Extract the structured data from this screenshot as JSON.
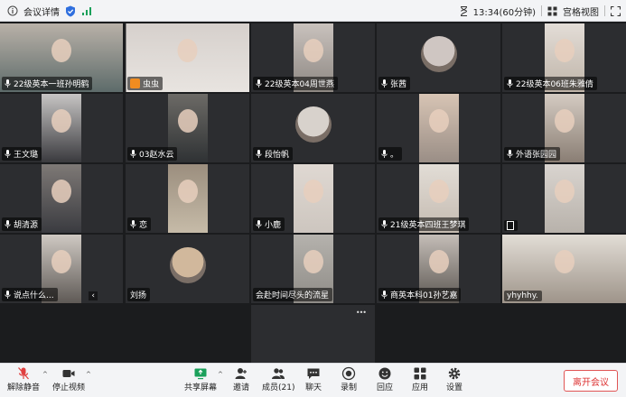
{
  "topbar": {
    "title": "会议详情",
    "time": "13:34(60分钟)",
    "view": "宫格视图"
  },
  "tiles": [
    {
      "label": "22级英本一班孙明鹤",
      "mic": true,
      "photo": "#b9b1a8",
      "photo2": "#5d6b6a"
    },
    {
      "label": "虫虫",
      "mic": false,
      "badge": true,
      "photo": "#d6d0cc",
      "photo2": "#e8e4e0"
    },
    {
      "label": "22级英本04周世燕",
      "mic": true,
      "photo": "#c9c2bd",
      "photo2": "#8d8782"
    },
    {
      "label": "张茜",
      "mic": true,
      "avatar": true,
      "photo": "#cfc6c2"
    },
    {
      "label": "22级英本06班朱雅倩",
      "mic": true,
      "photo": "#e3ddd7",
      "photo2": "#bfb4a8"
    },
    {
      "label": "王文璐",
      "mic": true,
      "photo": "#c7c5c4",
      "photo2": "#3a3a3e"
    },
    {
      "label": "03赵水云",
      "mic": true,
      "photo": "#6c6a66",
      "photo2": "#2f3234"
    },
    {
      "label": "段怡帆",
      "mic": true,
      "avatar": true,
      "photo": "#d8d2cc"
    },
    {
      "label": "。",
      "mic": true,
      "photo": "#d7c4b4",
      "photo2": "#9a8e86"
    },
    {
      "label": "外语张园园",
      "mic": true,
      "photo": "#d4cbc2",
      "photo2": "#8a7e74"
    },
    {
      "label": "胡清源",
      "mic": true,
      "photo": "#7e7976",
      "photo2": "#3a3b40"
    },
    {
      "label": "恋",
      "mic": true,
      "photo": "#9b8e7e",
      "photo2": "#c6bba8"
    },
    {
      "label": "小鹿",
      "mic": true,
      "photo": "#dfd8d2",
      "photo2": "#cdc6bf"
    },
    {
      "label": "21级英本四班王梦琪",
      "mic": true,
      "photo": "#e2ddd6",
      "photo2": "#c4bab0"
    },
    {
      "label": "",
      "mic": false,
      "square": true,
      "photo": "#d9d4cf",
      "photo2": "#b8b2ab"
    },
    {
      "label": "说点什么...",
      "mic": true,
      "photo": "#cfc9c3",
      "photo2": "#5f5a56",
      "chat": true
    },
    {
      "label": "刘扬",
      "mic": false,
      "avatar": true,
      "photo": "#d1b89c"
    },
    {
      "label": "会赴时间尽头的流星",
      "mic": false,
      "photo": "#b5b2ad",
      "photo2": "#8f8c87"
    },
    {
      "label": "商英本科01孙艺嘉",
      "mic": true,
      "photo": "#c4bdb7",
      "photo2": "#5b5651"
    },
    {
      "label": "yhyhhy.",
      "mic": false,
      "photo": "#e2ddd6",
      "photo2": "#9e948a"
    }
  ],
  "more_icon": "•••",
  "toolbar": {
    "unmute": "解除静音",
    "stop_video": "停止视频",
    "share": "共享屏幕",
    "invite": "邀请",
    "members": "成员(21)",
    "chat": "聊天",
    "record": "录制",
    "reactions": "回应",
    "apps": "应用",
    "settings": "设置",
    "leave": "离开会议"
  },
  "colors": {
    "mute_red": "#e04040",
    "share_green": "#1aa05a",
    "accent_blue": "#2f6fde",
    "leave_red": "#d33333"
  }
}
